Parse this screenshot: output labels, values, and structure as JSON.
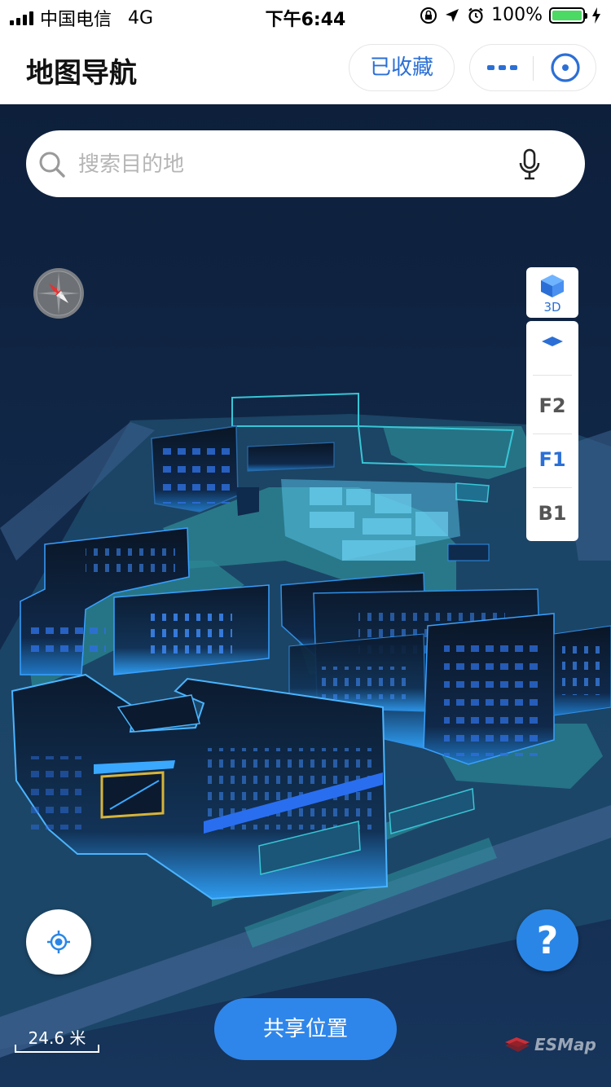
{
  "status_bar": {
    "carrier": "中国电信",
    "network": "4G",
    "time": "下午6:44",
    "battery": "100%",
    "battery_level": 1.0
  },
  "header": {
    "title": "地图导航",
    "favorite_label": "已收藏"
  },
  "search": {
    "placeholder": "搜索目的地"
  },
  "view_mode": {
    "label": "3D"
  },
  "floors": {
    "items": [
      "F2",
      "F1",
      "B1"
    ],
    "active": "F1"
  },
  "help": {
    "label": "?"
  },
  "share": {
    "label": "共享位置"
  },
  "scale": {
    "label": "24.6 米"
  },
  "brand": {
    "logo_text": "ESMap"
  },
  "colors": {
    "accent": "#2b6fd6",
    "map_background": "#0f2240",
    "building_glow": "#3aa8ff",
    "ground_teal": "#2f8f99"
  }
}
